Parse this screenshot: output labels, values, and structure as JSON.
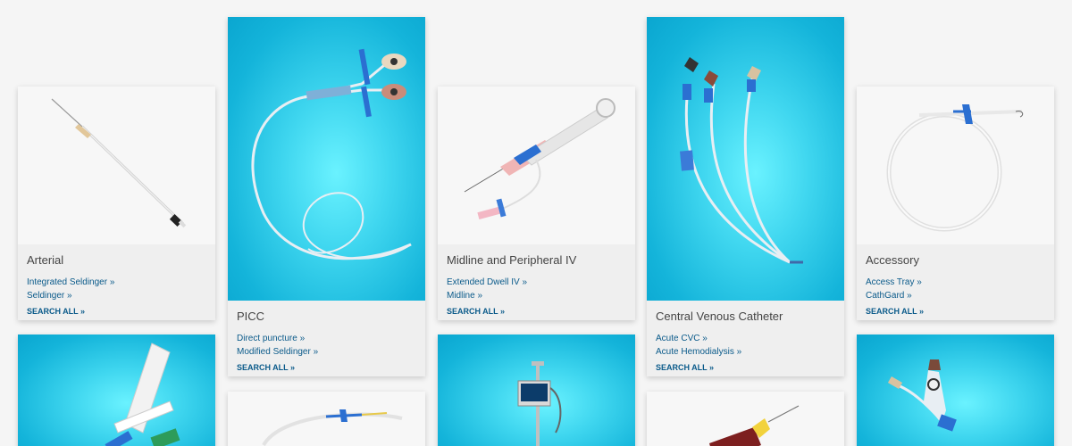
{
  "cards": [
    {
      "title": "Arterial",
      "links": [
        "Integrated Seldinger »",
        "Seldinger »"
      ],
      "search_all": "SEARCH ALL »"
    },
    {
      "title": "PICC",
      "links": [
        "Direct puncture »",
        "Modified Seldinger »"
      ],
      "search_all": "SEARCH ALL »"
    },
    {
      "title": "Midline and Peripheral IV",
      "links": [
        "Extended Dwell IV »",
        "Midline »"
      ],
      "search_all": "SEARCH ALL »"
    },
    {
      "title": "Central Venous Catheter",
      "links": [
        "Acute CVC »",
        "Acute Hemodialysis »"
      ],
      "search_all": "SEARCH ALL »"
    },
    {
      "title": "Accessory",
      "links": [
        "Access Tray »",
        "CathGard »"
      ],
      "search_all": "SEARCH ALL »"
    }
  ],
  "colors": {
    "page_bg": "#f5f5f5",
    "card_bg": "#efefef",
    "link": "#0a5a8a",
    "title": "#444444",
    "image_blue": "#14b4da"
  },
  "images": [
    "arterial-catheter",
    "picc-catheter",
    "midline-iv-catheter",
    "central-venous-catheter",
    "accessory-guidewire",
    "syringe-kit",
    "guidewire-coil",
    "ultrasound-monitor-stand",
    "insertion-device",
    "multi-lumen-catheter"
  ]
}
